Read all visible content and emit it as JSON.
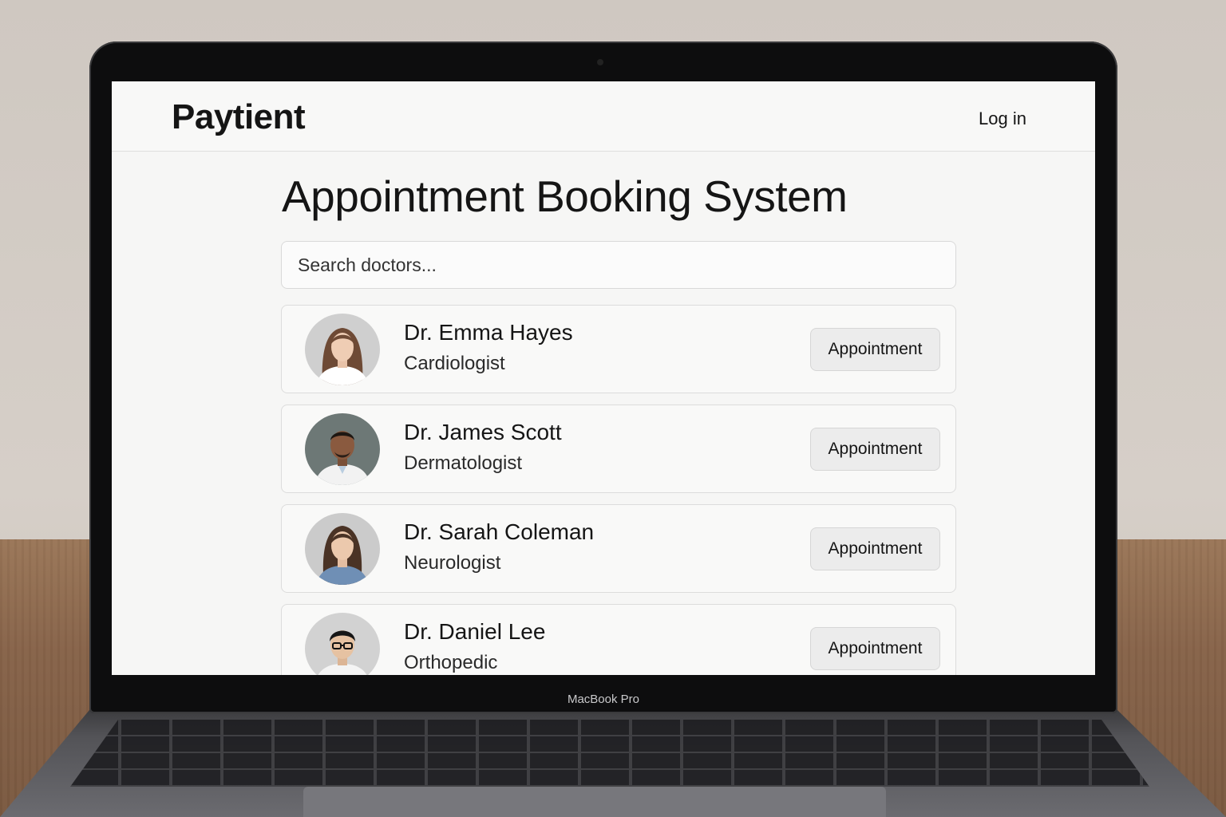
{
  "device": {
    "label": "MacBook Pro"
  },
  "header": {
    "brand": "Paytient",
    "login_label": "Log in"
  },
  "main": {
    "title": "Appointment Booking System",
    "search": {
      "placeholder": "Search doctors...",
      "value": ""
    }
  },
  "doctors": [
    {
      "name": "Dr. Emma Hayes",
      "specialty": "Cardiologist",
      "action_label": "Appointment"
    },
    {
      "name": "Dr. James Scott",
      "specialty": "Dermatologist",
      "action_label": "Appointment"
    },
    {
      "name": "Dr. Sarah Coleman",
      "specialty": "Neurologist",
      "action_label": "Appointment"
    },
    {
      "name": "Dr. Daniel Lee",
      "specialty": "Orthopedic",
      "action_label": "Appointment"
    }
  ],
  "colors": {
    "screen_background": "#f6f6f5",
    "text": "#151515",
    "button_background": "#ececec",
    "card_border": "#dcdcdc"
  }
}
